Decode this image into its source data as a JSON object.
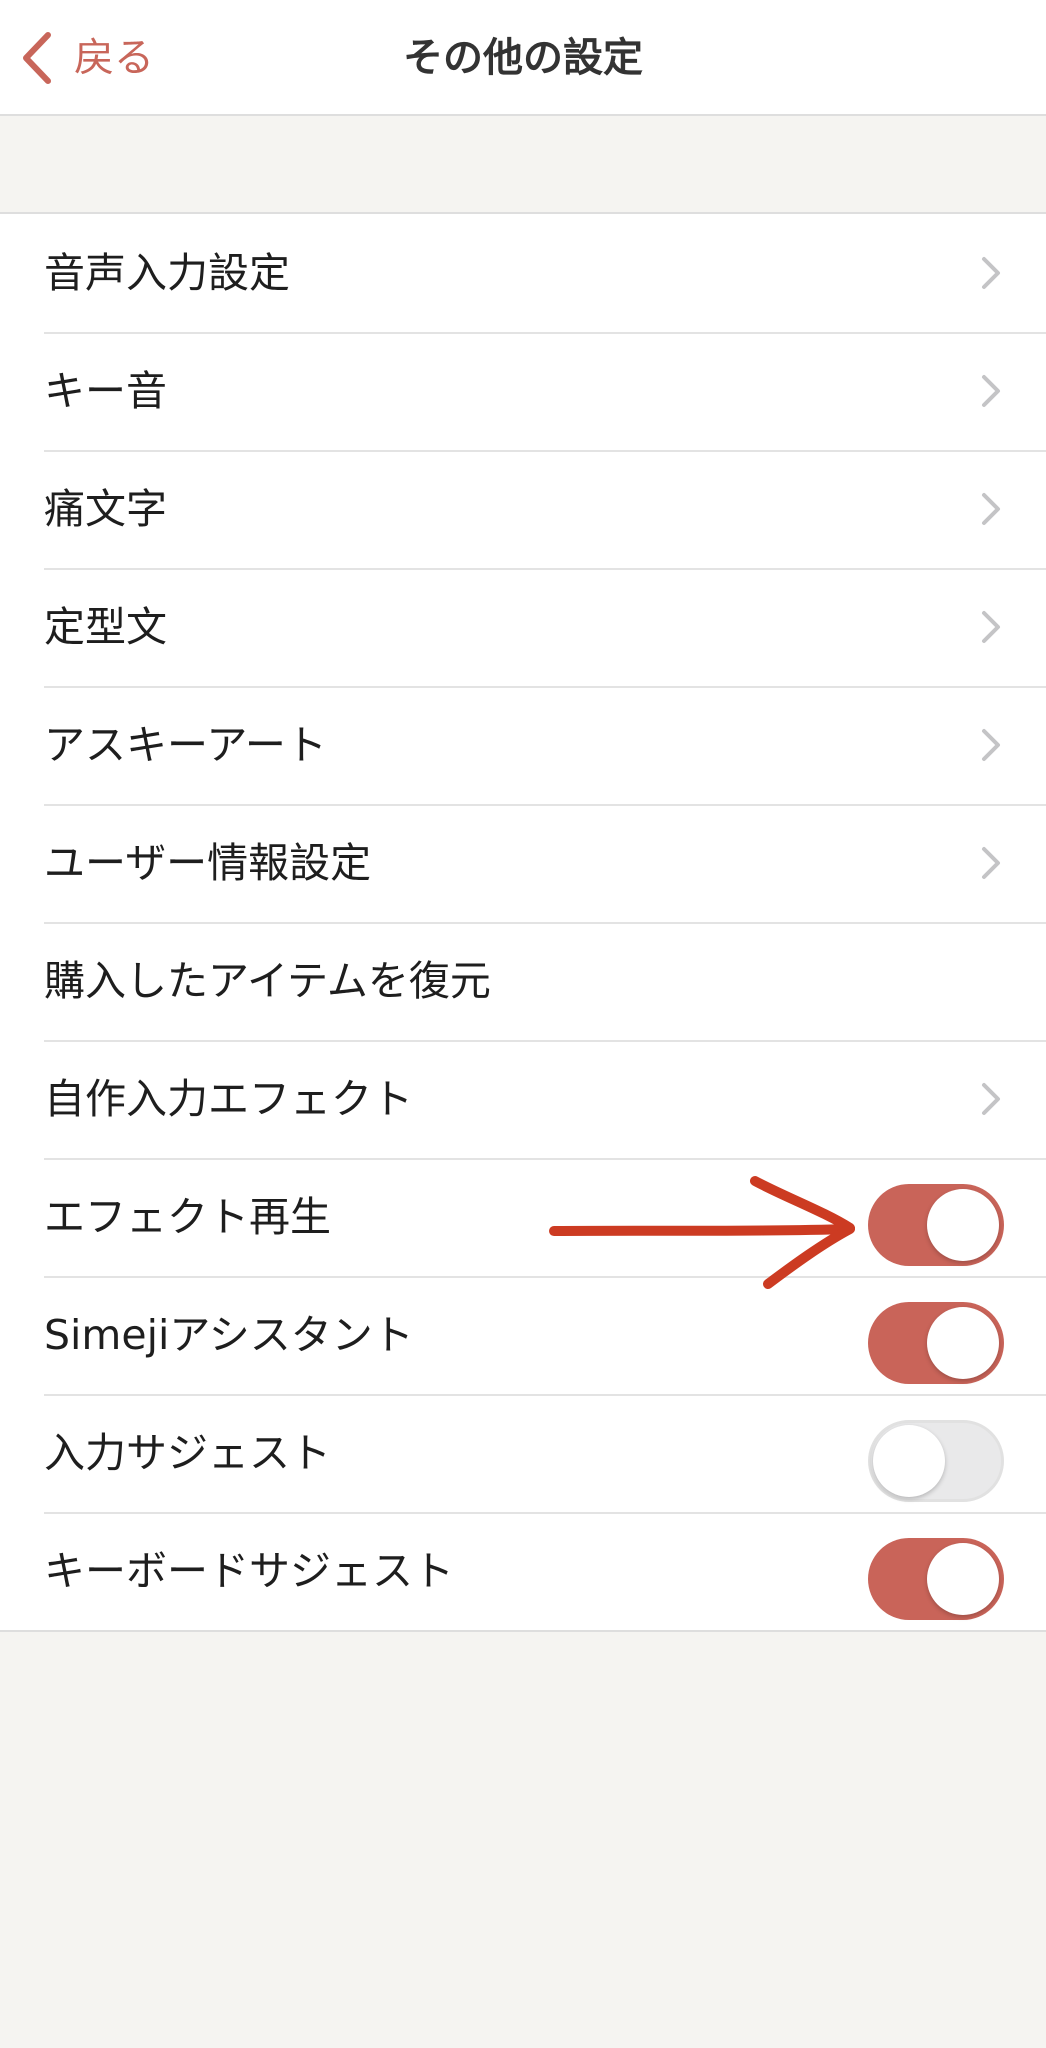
{
  "header": {
    "back_label": "戻る",
    "title": "その他の設定"
  },
  "settings": {
    "items": [
      {
        "label": "音声入力設定",
        "control": "chevron"
      },
      {
        "label": "キー音",
        "control": "chevron"
      },
      {
        "label": "痛文字",
        "control": "chevron"
      },
      {
        "label": "定型文",
        "control": "chevron"
      },
      {
        "label": "アスキーアート",
        "control": "chevron"
      },
      {
        "label": "ユーザー情報設定",
        "control": "chevron"
      },
      {
        "label": "購入したアイテムを復元",
        "control": "none"
      },
      {
        "label": "自作入力エフェクト",
        "control": "chevron"
      },
      {
        "label": "エフェクト再生",
        "control": "toggle",
        "on": true
      },
      {
        "label": "Simejiアシスタント",
        "control": "toggle",
        "on": true
      },
      {
        "label": "入力サジェスト",
        "control": "toggle",
        "on": false
      },
      {
        "label": "キーボードサジェスト",
        "control": "toggle",
        "on": true
      }
    ]
  },
  "icons": {
    "back": "chevron-left-icon",
    "row_disclosure": "chevron-right-icon",
    "annotation": "arrow-annotation-icon"
  },
  "colors": {
    "accent": "#c96459",
    "back_tint": "#c8665a",
    "annotation": "#cc3b22",
    "background": "#f5f4f1",
    "toggle_off": "#e9e9ea"
  }
}
